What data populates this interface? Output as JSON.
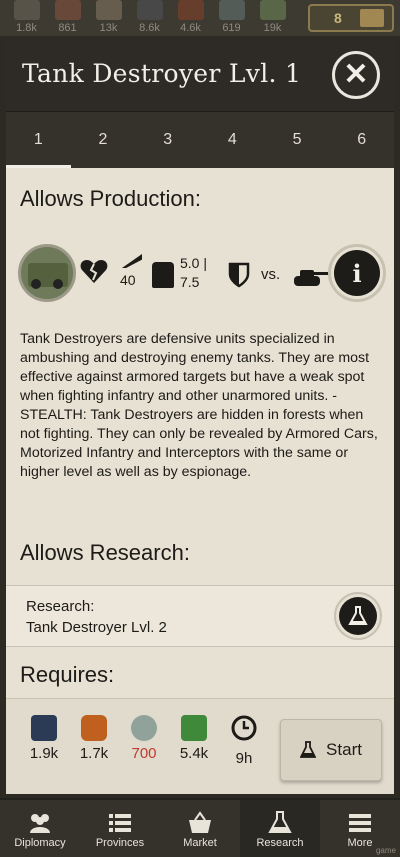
{
  "resources": [
    {
      "icon": "manpower-icon",
      "value": "1.8k"
    },
    {
      "icon": "oil-barrel-icon",
      "value": "861"
    },
    {
      "icon": "supplies-icon",
      "value": "13k"
    },
    {
      "icon": "steel-icon",
      "value": "8.6k"
    },
    {
      "icon": "fuel-icon",
      "value": "4.6k"
    },
    {
      "icon": "rare-materials-icon",
      "value": "619"
    },
    {
      "icon": "money-icon",
      "value": "19k"
    }
  ],
  "gold": {
    "value": "8",
    "icon": "gold-bars-icon"
  },
  "header": {
    "title": "Tank Destroyer Lvl. 1"
  },
  "tabs": [
    "1",
    "2",
    "3",
    "4",
    "5",
    "6"
  ],
  "active_tab": "1",
  "production": {
    "heading": "Allows Production:",
    "attack": "40",
    "strength": "5.0 |\n7.5",
    "vs_label": "vs.",
    "description": "Tank Destroyers are defensive units specialized in ambushing and destroying enemy tanks. They are most effective against armored targets but have a weak spot when fighting infantry and other unarmored units. - STEALTH: Tank Destroyers are hidden in forests when not fighting. They can only be revealed by Armored Cars, Motorized Infantry and Interceptors with the same or higher level as well as by espionage."
  },
  "research": {
    "heading": "Allows Research:",
    "label": "Research:",
    "item": "Tank Destroyer Lvl. 2"
  },
  "requires": {
    "heading": "Requires:"
  },
  "costs": [
    {
      "icon": "steel-beam-icon",
      "value": "1.9k",
      "short": false
    },
    {
      "icon": "oil-barrel-icon",
      "value": "1.7k",
      "short": false
    },
    {
      "icon": "rare-materials-icon",
      "value": "700",
      "short": true
    },
    {
      "icon": "money-icon",
      "value": "5.4k",
      "short": false
    },
    {
      "icon": "clock-icon",
      "value": "9h",
      "short": false
    }
  ],
  "start_button": {
    "label": "Start"
  },
  "nav": [
    {
      "label": "Diplomacy",
      "icon": "diplomacy-icon"
    },
    {
      "label": "Provinces",
      "icon": "provinces-list-icon"
    },
    {
      "label": "Market",
      "icon": "market-basket-icon"
    },
    {
      "label": "Research",
      "icon": "research-flask-icon",
      "active": true
    },
    {
      "label": "More",
      "icon": "menu-icon"
    }
  ],
  "watermark": "game",
  "colors": {
    "accent_red": "#c0392b",
    "panel": "#e6e1d3",
    "dark": "#2e2b26"
  }
}
